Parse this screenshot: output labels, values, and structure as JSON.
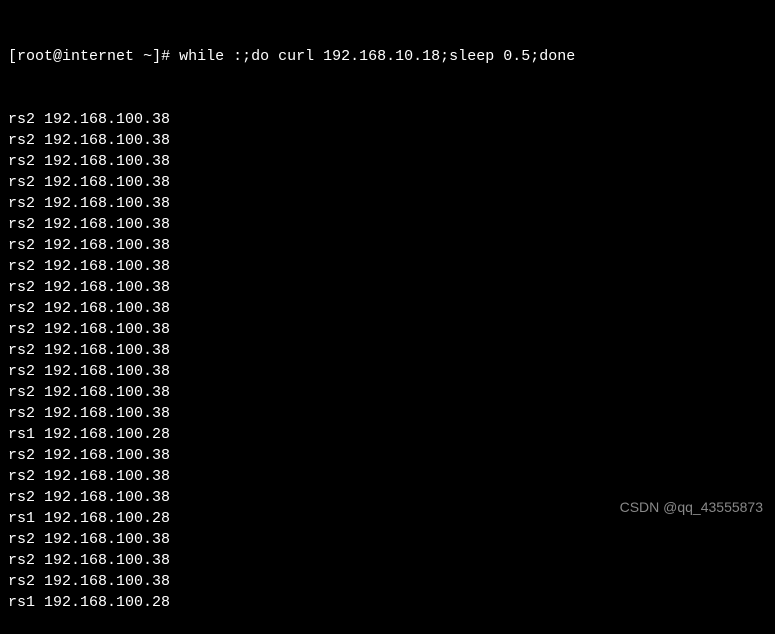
{
  "prompt": {
    "user": "root",
    "host": "internet",
    "path": "~",
    "symbol": "#"
  },
  "command": "while :;do curl 192.168.10.18;sleep 0.5;done",
  "output": [
    "rs2 192.168.100.38",
    "rs2 192.168.100.38",
    "rs2 192.168.100.38",
    "rs2 192.168.100.38",
    "rs2 192.168.100.38",
    "rs2 192.168.100.38",
    "rs2 192.168.100.38",
    "rs2 192.168.100.38",
    "rs2 192.168.100.38",
    "rs2 192.168.100.38",
    "rs2 192.168.100.38",
    "rs2 192.168.100.38",
    "rs2 192.168.100.38",
    "rs2 192.168.100.38",
    "rs2 192.168.100.38",
    "rs1 192.168.100.28",
    "rs2 192.168.100.38",
    "rs2 192.168.100.38",
    "rs2 192.168.100.38",
    "rs1 192.168.100.28",
    "rs2 192.168.100.38",
    "rs2 192.168.100.38",
    "rs2 192.168.100.38",
    "rs1 192.168.100.28"
  ],
  "watermark": "CSDN @qq_43555873"
}
